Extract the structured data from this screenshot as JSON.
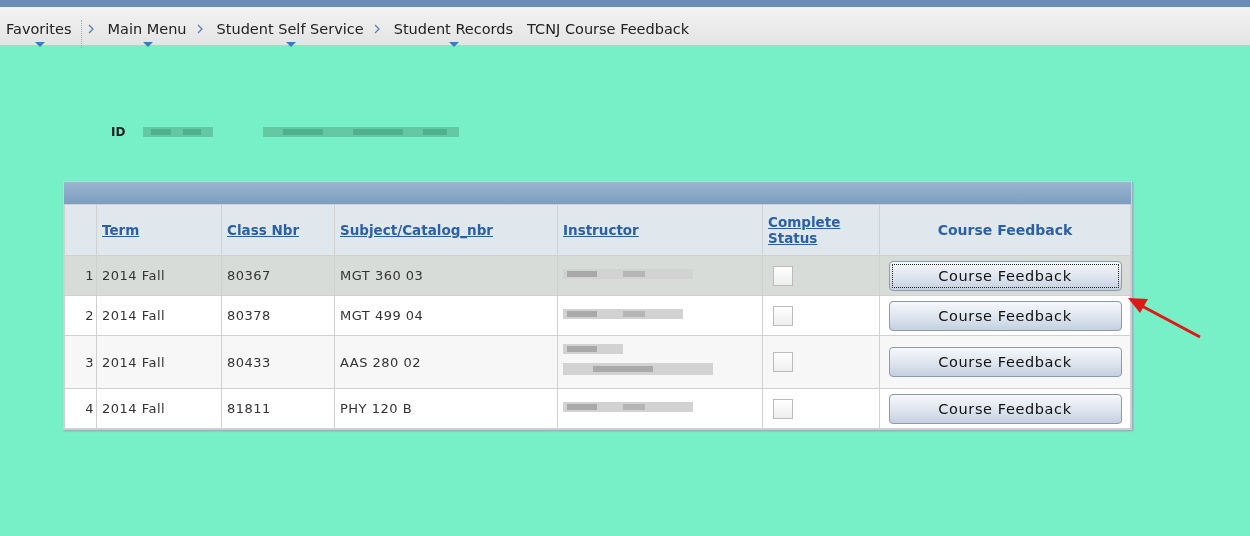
{
  "breadcrumb": [
    {
      "label": "Favorites",
      "menu": true,
      "separator": false
    },
    {
      "label": "Main Menu",
      "menu": true,
      "separator": true
    },
    {
      "label": "Student Self Service",
      "menu": true,
      "separator": true
    },
    {
      "label": "Student Records",
      "menu": true,
      "separator": true
    },
    {
      "label": "TCNJ Course Feedback",
      "menu": false,
      "separator": false
    }
  ],
  "id_label": "ID",
  "table": {
    "columns": [
      {
        "label": "Term",
        "link": true
      },
      {
        "label": "Class Nbr",
        "link": true
      },
      {
        "label": "Subject/Catalog_nbr",
        "link": true
      },
      {
        "label": "Instructor",
        "link": true
      },
      {
        "label": "Complete Status",
        "link": true
      },
      {
        "label": "Course Feedback",
        "link": false
      }
    ],
    "rows": [
      {
        "num": "1",
        "term": "2014 Fall",
        "class_nbr": "80367",
        "subject": "MGT 360 03",
        "complete": false,
        "button": "Course Feedback",
        "focused": true,
        "selected": true
      },
      {
        "num": "2",
        "term": "2014 Fall",
        "class_nbr": "80378",
        "subject": "MGT 499 04",
        "complete": false,
        "button": "Course Feedback",
        "focused": false,
        "selected": false
      },
      {
        "num": "3",
        "term": "2014 Fall",
        "class_nbr": "80433",
        "subject": "AAS 280 02",
        "complete": false,
        "button": "Course Feedback",
        "focused": false,
        "selected": false
      },
      {
        "num": "4",
        "term": "2014 Fall",
        "class_nbr": "81811",
        "subject": "PHY 120 B",
        "complete": false,
        "button": "Course Feedback",
        "focused": false,
        "selected": false
      }
    ]
  }
}
